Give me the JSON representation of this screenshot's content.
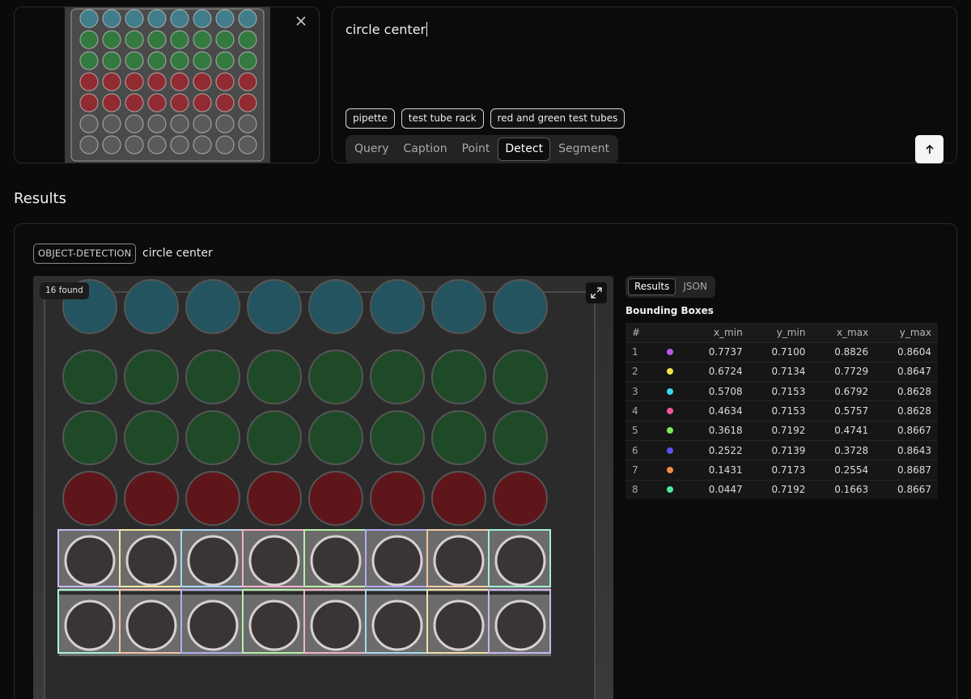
{
  "input": {
    "query_value": "circle center",
    "suggestions": [
      "pipette",
      "test tube rack",
      "red and green test tubes"
    ],
    "modes": [
      "Query",
      "Caption",
      "Point",
      "Detect",
      "Segment"
    ],
    "active_mode": "Detect",
    "close_icon": "close-icon",
    "send_icon": "arrow-up-icon"
  },
  "results": {
    "section_title": "Results",
    "task_badge": "OBJECT-DETECTION",
    "task_query": "circle center",
    "found_label": "16 found",
    "view_tabs": [
      "Results",
      "JSON"
    ],
    "active_view": "Results",
    "table_title": "Bounding Boxes",
    "columns": [
      "#",
      "",
      "x_min",
      "y_min",
      "x_max",
      "y_max"
    ],
    "rows": [
      {
        "idx": "1",
        "color": "#c056e8",
        "x_min": "0.7737",
        "y_min": "0.7100",
        "x_max": "0.8826",
        "y_max": "0.8604"
      },
      {
        "idx": "2",
        "color": "#f2e24a",
        "x_min": "0.6724",
        "y_min": "0.7134",
        "x_max": "0.7729",
        "y_max": "0.8647"
      },
      {
        "idx": "3",
        "color": "#3ed6f0",
        "x_min": "0.5708",
        "y_min": "0.7153",
        "x_max": "0.6792",
        "y_max": "0.8628"
      },
      {
        "idx": "4",
        "color": "#f0549a",
        "x_min": "0.4634",
        "y_min": "0.7153",
        "x_max": "0.5757",
        "y_max": "0.8628"
      },
      {
        "idx": "5",
        "color": "#7ee85a",
        "x_min": "0.3618",
        "y_min": "0.7192",
        "x_max": "0.4741",
        "y_max": "0.8667"
      },
      {
        "idx": "6",
        "color": "#5b55f0",
        "x_min": "0.2522",
        "y_min": "0.7139",
        "x_max": "0.3728",
        "y_max": "0.8643"
      },
      {
        "idx": "7",
        "color": "#f08a4a",
        "x_min": "0.1431",
        "y_min": "0.7173",
        "x_max": "0.2554",
        "y_max": "0.8687"
      },
      {
        "idx": "8",
        "color": "#4ae8a0",
        "x_min": "0.0447",
        "y_min": "0.7192",
        "x_max": "0.1663",
        "y_max": "0.8667"
      }
    ],
    "box_colors": [
      "#c8b6f0",
      "#f2e7a6",
      "#a9d8f0",
      "#f2b2cc",
      "#b8f0a6",
      "#b3a9f0",
      "#f2c8a6",
      "#a6f0d0",
      "#a6f0d8",
      "#f2c2a6",
      "#b0b0f0",
      "#b6f0a6",
      "#f2b2cc",
      "#a9d8f0",
      "#f2e0a6",
      "#c8b6f0"
    ]
  }
}
